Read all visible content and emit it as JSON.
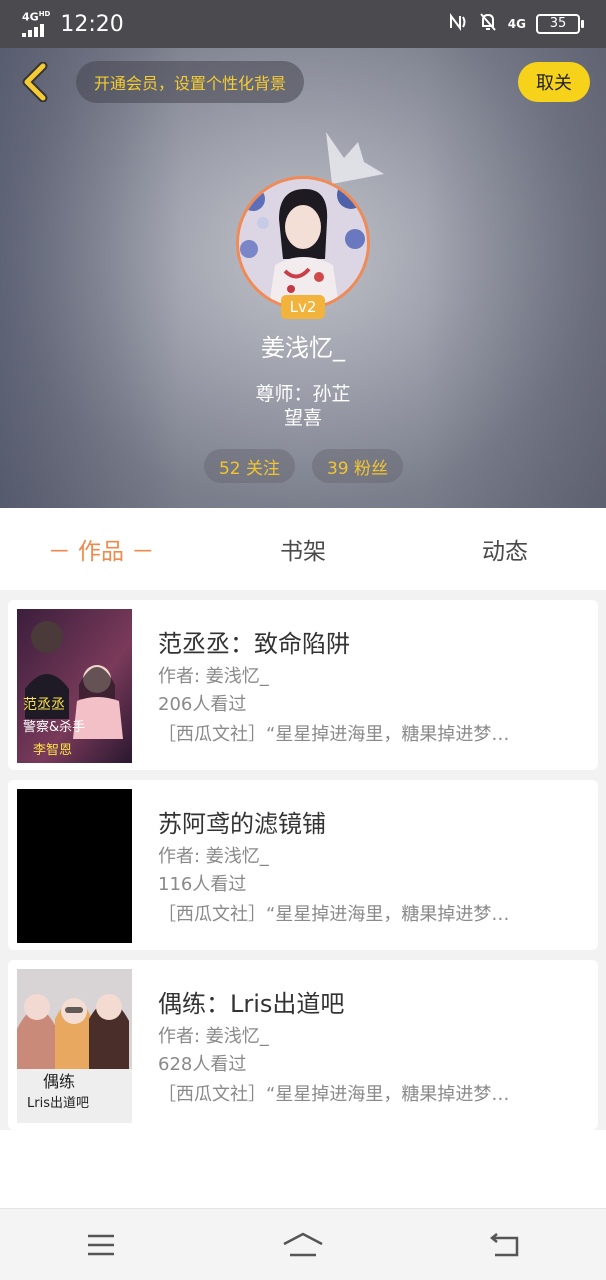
{
  "status_bar": {
    "network": "4G",
    "network_sup": "HD",
    "time": "12:20",
    "mobile_data": "4G",
    "battery": "35"
  },
  "header": {
    "promo_text": "开通会员，设置个性化背景",
    "follow_button": "取关",
    "level": "Lv2",
    "username": "姜浅忆_",
    "mentor_line1": "尊师：孙芷",
    "mentor_line2": "望喜",
    "following": "52 关注",
    "fans": "39 粉丝"
  },
  "tabs": [
    {
      "label": "－ 作品 －",
      "active": true
    },
    {
      "label": "书架",
      "active": false
    },
    {
      "label": "动态",
      "active": false
    }
  ],
  "works": [
    {
      "title": "范丞丞：致命陷阱",
      "author": "作者: 姜浅忆_",
      "views": "206人看过",
      "desc": "［西瓜文社］“星星掉进海里，糖果掉进梦…",
      "cover_text_1": "范丞丞",
      "cover_text_2": "警察&杀手",
      "cover_text_3": "李智恩"
    },
    {
      "title": "苏阿鸢的滤镜铺",
      "author": "作者: 姜浅忆_",
      "views": "116人看过",
      "desc": "［西瓜文社］“星星掉进海里，糖果掉进梦…"
    },
    {
      "title": "偶练：Lris出道吧",
      "author": "作者: 姜浅忆_",
      "views": "628人看过",
      "desc": "［西瓜文社］“星星掉进海里，糖果掉进梦…",
      "cover_text_1": "偶练",
      "cover_text_2": "Lris出道吧"
    }
  ],
  "colors": {
    "accent_orange": "#f08a4b",
    "gold": "#f2c530",
    "follow_yellow": "#f7d21b"
  }
}
